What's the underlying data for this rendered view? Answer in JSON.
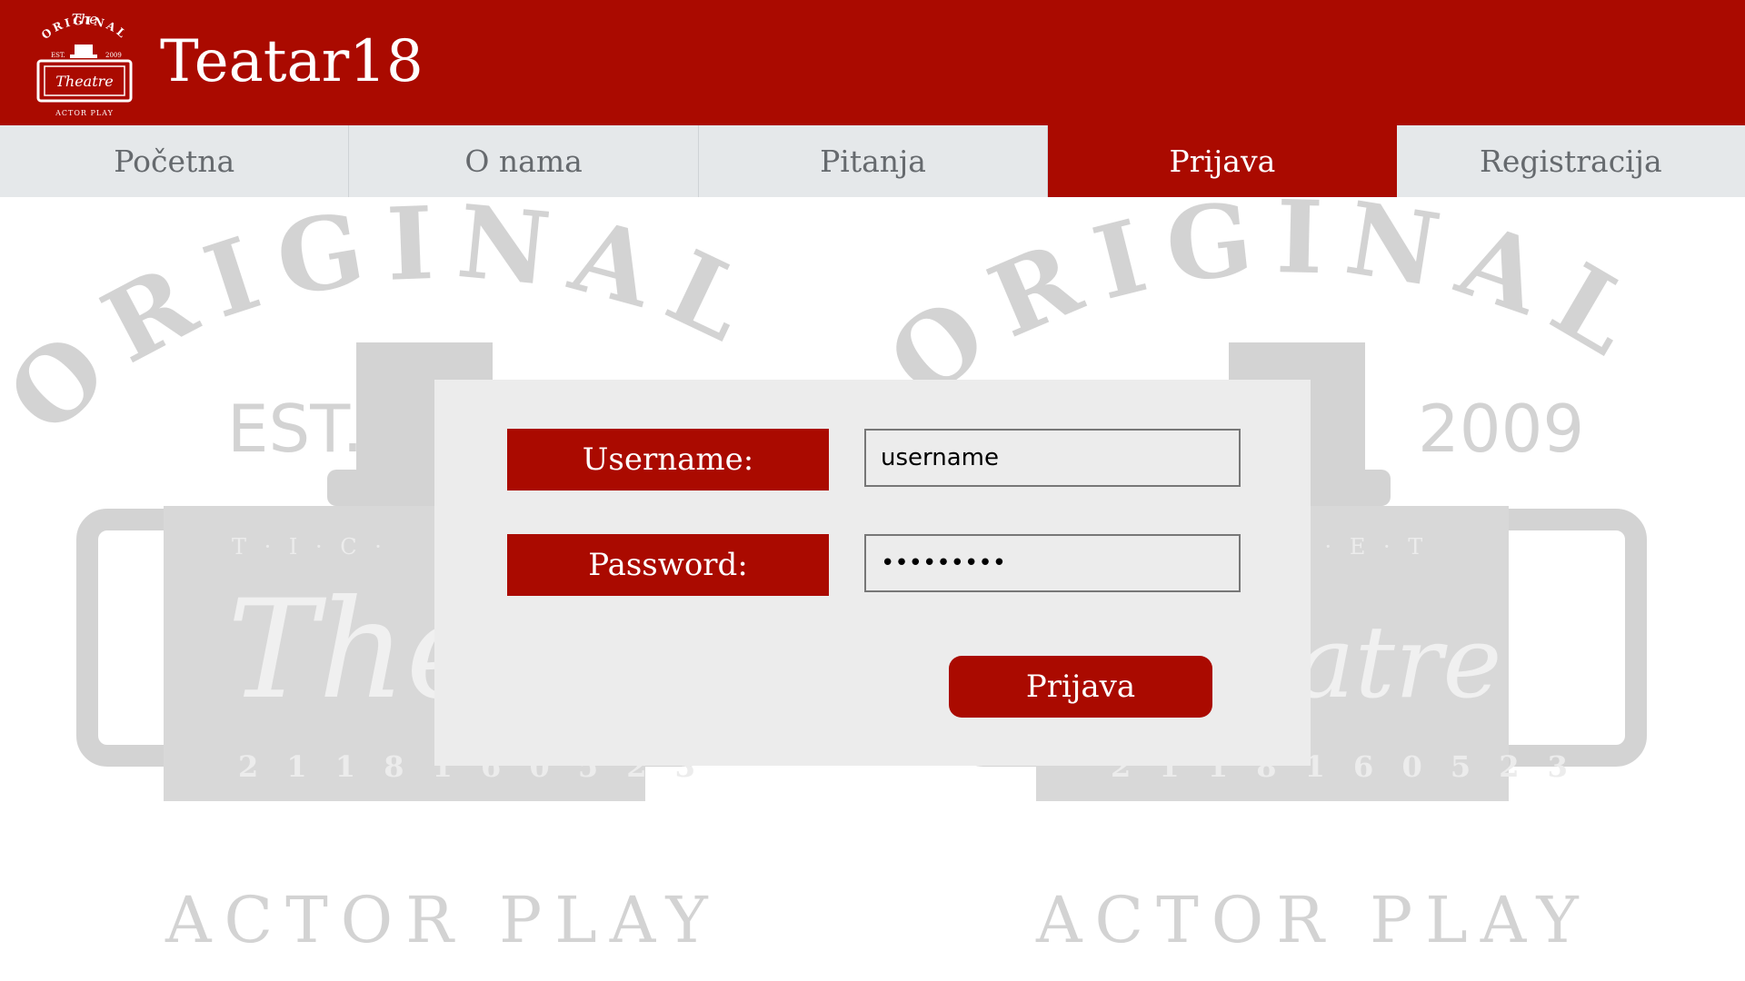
{
  "app": {
    "title": "Teatar18",
    "brand_color": "#aa0a00",
    "logo": {
      "icon": "theatre-logo-icon",
      "top_text": "The",
      "arc_text": "ORIGINAL",
      "est": "EST.",
      "year": "2009",
      "center_text": "Theatre",
      "bottom_text": "ACTOR PLAY"
    }
  },
  "nav": {
    "items": [
      {
        "label": "Početna"
      },
      {
        "label": "O nama"
      },
      {
        "label": "Pitanja"
      },
      {
        "label": "Prijava",
        "active": true
      },
      {
        "label": "Registracija"
      }
    ]
  },
  "watermark": {
    "arc_text": "ORIGINAL",
    "est": "EST.",
    "year": "2009",
    "ticket_text": "T · I · C · K · E · T",
    "ticket_short_left": "T · I · C ·",
    "ticket_short_right": "K · E · T",
    "center_text": "Theatre",
    "center_left": "The",
    "center_right": "atre",
    "number": "2 1 1 8 1 6 0 5 2 3",
    "bottom_text": "ACTOR PLAY"
  },
  "login": {
    "username_label": "Username:",
    "password_label": "Password:",
    "username_value": "username",
    "password_value": "•••••••••",
    "submit_label": "Prijava"
  }
}
